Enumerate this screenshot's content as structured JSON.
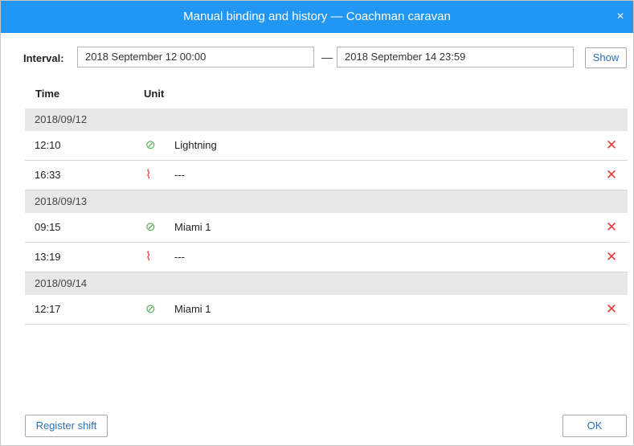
{
  "dialog": {
    "title": "Manual binding and history — Coachman caravan",
    "close_glyph": "×"
  },
  "interval": {
    "label": "Interval:",
    "from": "2018 September 12 00:00",
    "separator": "—",
    "to": "2018 September 14 23:59",
    "show_label": "Show"
  },
  "table": {
    "headers": {
      "time": "Time",
      "unit": "Unit"
    },
    "groups": [
      {
        "date": "2018/09/12",
        "rows": [
          {
            "time": "12:10",
            "icon": "bind-icon",
            "unit": "Lightning"
          },
          {
            "time": "16:33",
            "icon": "unbind-icon",
            "unit": "---"
          }
        ]
      },
      {
        "date": "2018/09/13",
        "rows": [
          {
            "time": "09:15",
            "icon": "bind-icon",
            "unit": "Miami 1"
          },
          {
            "time": "13:19",
            "icon": "unbind-icon",
            "unit": "---"
          }
        ]
      },
      {
        "date": "2018/09/14",
        "rows": [
          {
            "time": "12:17",
            "icon": "bind-icon",
            "unit": "Miami 1"
          }
        ]
      }
    ],
    "delete_glyph": "✕"
  },
  "footer": {
    "register_label": "Register shift",
    "ok_label": "OK"
  },
  "colors": {
    "titlebar": "#2196f3",
    "bind": "#4caf50",
    "unbind": "#e53935",
    "delete": "#e53935",
    "link_text": "#2b6fb0"
  }
}
